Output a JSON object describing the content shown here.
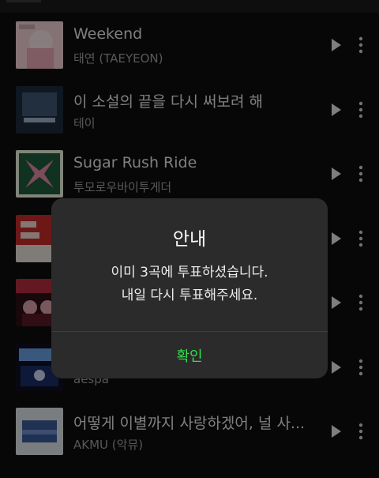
{
  "songs": [
    {
      "title": "Weekend",
      "artist": "태연 (TAEYEON)",
      "cover_colors": [
        "#f1d0d6",
        "#e7a6b4"
      ]
    },
    {
      "title": "이 소설의 끝을 다시 써보려 해",
      "artist": "테이",
      "cover_colors": [
        "#1d2b3c",
        "#3e5773"
      ]
    },
    {
      "title": "Sugar Rush Ride",
      "artist": "투모로우바이투게더",
      "cover_colors": [
        "#e9f0e0",
        "#c34c68"
      ]
    },
    {
      "title": "",
      "artist": "",
      "cover_colors": [
        "#c62b2b",
        "#e8e0d8"
      ]
    },
    {
      "title": "",
      "artist": "",
      "cover_colors": [
        "#b62f3f",
        "#2a1015"
      ]
    },
    {
      "title": "",
      "artist": "aespa",
      "cover_colors": [
        "#1a2f6b",
        "#6aa0e0"
      ]
    },
    {
      "title": "어떻게 이별까지 사랑하겠어, 널 사...",
      "artist": "AKMU (악뮤)",
      "cover_colors": [
        "#dfe3ea",
        "#3a5b9a"
      ]
    }
  ],
  "dialog": {
    "title": "안내",
    "line1": "이미 3곡에 투표하셨습니다.",
    "line2": "내일 다시 투표해주세요.",
    "confirm": "확인"
  },
  "colors": {
    "accent": "#2fe34a",
    "dialog_bg": "#2b2b2b",
    "background": "#0d0d0d"
  },
  "icons": {
    "play": "play-icon",
    "more": "more-vertical-icon"
  }
}
